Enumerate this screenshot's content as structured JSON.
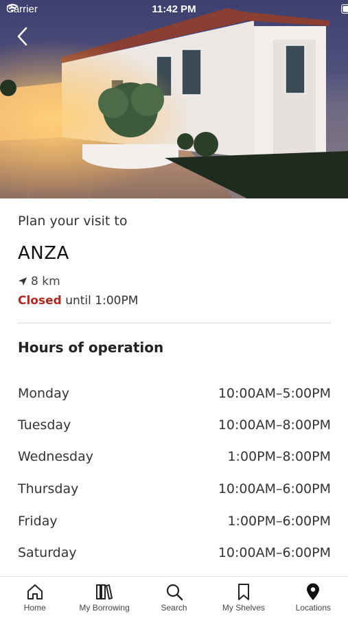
{
  "status_bar": {
    "carrier": "Carrier",
    "time": "11:42 PM"
  },
  "header": {
    "plan_label": "Plan your visit to",
    "branch_name": "ANZA"
  },
  "location": {
    "distance": "8 km"
  },
  "status": {
    "state": "Closed",
    "detail": "until 1:00PM",
    "state_color": "#b3261e"
  },
  "hours": {
    "title": "Hours of operation",
    "rows": [
      {
        "day": "Monday",
        "time": "10:00AM–5:00PM"
      },
      {
        "day": "Tuesday",
        "time": "10:00AM–8:00PM"
      },
      {
        "day": "Wednesday",
        "time": "1:00PM–8:00PM"
      },
      {
        "day": "Thursday",
        "time": "10:00AM–6:00PM"
      },
      {
        "day": "Friday",
        "time": "1:00PM–6:00PM"
      },
      {
        "day": "Saturday",
        "time": "10:00AM–6:00PM"
      }
    ]
  },
  "tabbar": {
    "items": [
      {
        "label": "Home",
        "icon": "home-icon"
      },
      {
        "label": "My Borrowing",
        "icon": "books-icon"
      },
      {
        "label": "Search",
        "icon": "search-icon"
      },
      {
        "label": "My Shelves",
        "icon": "bookmark-icon"
      },
      {
        "label": "Locations",
        "icon": "location-pin-icon"
      }
    ]
  }
}
